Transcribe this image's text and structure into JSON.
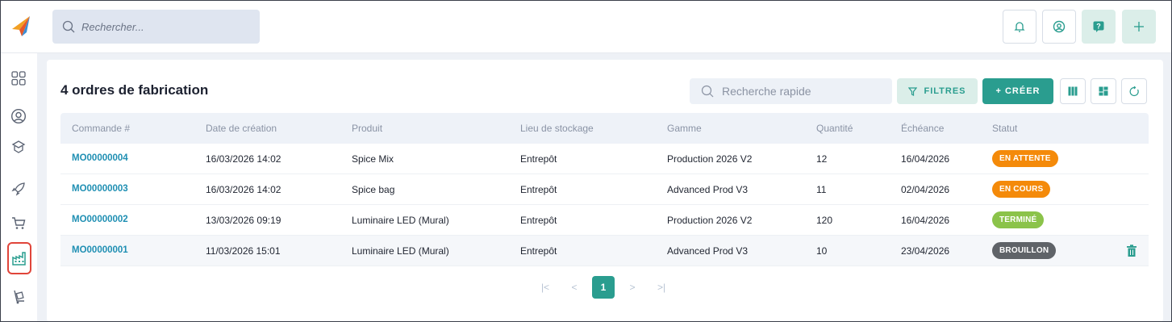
{
  "topbar": {
    "search_placeholder": "Rechercher...",
    "icons": [
      "bell-icon",
      "user-circle-icon",
      "help-icon",
      "plus-icon"
    ]
  },
  "sidebar": {
    "items": [
      "dashboard-icon",
      "user-icon",
      "box-icon",
      "rocket-icon",
      "cart-icon",
      "factory-icon",
      "shipping-icon"
    ],
    "active": "factory-icon"
  },
  "panel": {
    "title": "4 ordres de fabrication",
    "quick_search_placeholder": "Recherche rapide",
    "filter_label": "FILTRES",
    "create_label": "+ CRÉER"
  },
  "table": {
    "columns": [
      "Commande #",
      "Date de création",
      "Produit",
      "Lieu de stockage",
      "Gamme",
      "Quantité",
      "Échéance",
      "Statut"
    ],
    "rows": [
      {
        "order": "MO00000004",
        "created": "16/03/2026 14:02",
        "product": "Spice Mix",
        "location": "Entrepôt",
        "range": "Production 2026 V2",
        "qty": "12",
        "due": "16/04/2026",
        "status": "EN ATTENTE",
        "status_color": "#f48a0a"
      },
      {
        "order": "MO00000003",
        "created": "16/03/2026 14:02",
        "product": "Spice bag",
        "location": "Entrepôt",
        "range": "Advanced Prod V3",
        "qty": "11",
        "due": "02/04/2026",
        "status": "EN COURS",
        "status_color": "#f48a0a"
      },
      {
        "order": "MO00000002",
        "created": "13/03/2026 09:19",
        "product": "Luminaire LED (Mural)",
        "location": "Entrepôt",
        "range": "Production 2026 V2",
        "qty": "120",
        "due": "16/04/2026",
        "status": "TERMINÉ",
        "status_color": "#8bc34a"
      },
      {
        "order": "MO00000001",
        "created": "11/03/2026 15:01",
        "product": "Luminaire LED (Mural)",
        "location": "Entrepôt",
        "range": "Advanced Prod V3",
        "qty": "10",
        "due": "23/04/2026",
        "status": "BROUILLON",
        "status_color": "#5f6368"
      }
    ]
  },
  "pagination": {
    "first": "|<",
    "prev": "<",
    "current": "1",
    "next": ">",
    "last": ">|"
  },
  "colors": {
    "accent": "#2a9d8f",
    "link": "#1f8fb3",
    "active_outline": "#e0453a"
  }
}
